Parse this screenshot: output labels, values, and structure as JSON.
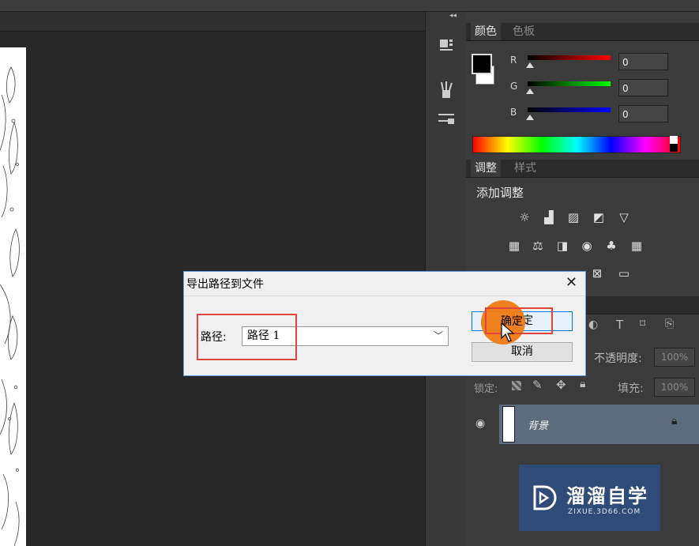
{
  "colors": {
    "accent_orange": "#f07a13",
    "highlight_red": "#e0443a",
    "layer_selected": "#5e6b7b",
    "dialog_border": "#6aa0d6"
  },
  "toolstrip": {
    "collapse_glyph": "◂◂",
    "icons": [
      "cube-icon",
      "brush-presets-icon",
      "tool-presets-icon"
    ]
  },
  "color_panel": {
    "tabs": [
      "颜色",
      "色板"
    ],
    "channels": [
      {
        "label": "R",
        "value": "0",
        "color": "#e02020"
      },
      {
        "label": "G",
        "value": "0",
        "color": "#20c020"
      },
      {
        "label": "B",
        "value": "0",
        "color": "#2040ff"
      }
    ]
  },
  "adjustments_panel": {
    "tabs": [
      "调整",
      "样式"
    ],
    "heading": "添加调整",
    "row1_icons": [
      "brightness-icon",
      "levels-icon",
      "curves-icon",
      "exposure-icon",
      "vibrance-icon"
    ],
    "row2_icons": [
      "hue-saturation-icon",
      "color-balance-icon",
      "black-white-icon",
      "photo-filter-icon",
      "channel-mixer-icon",
      "color-lookup-icon"
    ],
    "row3_icons": [
      "invert-icon",
      "posterize-icon",
      "threshold-icon",
      "selective-color-icon",
      "gradient-map-icon"
    ]
  },
  "layers_panel": {
    "filter_icons": [
      "adjustment-filter-icon",
      "type-filter-icon",
      "shape-filter-icon",
      "smart-object-filter-icon"
    ],
    "opacity_label": "不透明度:",
    "opacity_value": "100%",
    "lock_label": "锁定:",
    "fill_label": "填充:",
    "fill_value": "100%",
    "layer_name": "背景"
  },
  "dialog": {
    "title": "导出路径到文件",
    "close_glyph": "✕",
    "path_label": "路径:",
    "path_value": "路径 1",
    "ok_label": "确定",
    "cancel_label": "取消"
  },
  "watermark": {
    "brand": "溜溜自学",
    "url": "ZIXUE.3D66.COM"
  }
}
